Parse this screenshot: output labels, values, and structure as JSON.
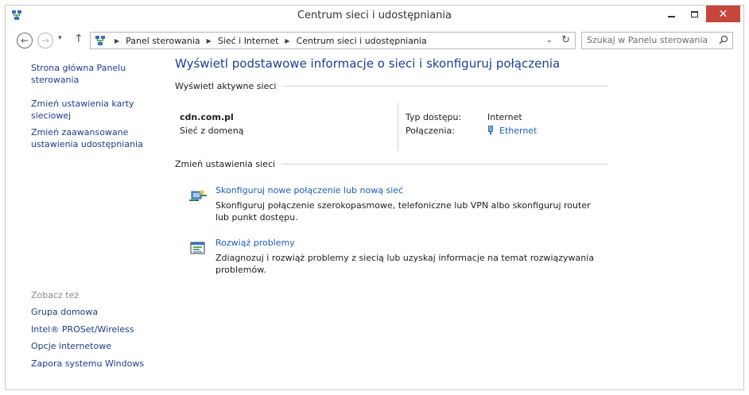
{
  "window": {
    "title": "Centrum sieci i udostępniania",
    "close_glyph": "✕"
  },
  "nav": {
    "back_glyph": "←",
    "forward_glyph": "→",
    "recent_glyph": "▾",
    "up_glyph": "↑",
    "breadcrumbs": [
      "Panel sterowania",
      "Sieć i Internet",
      "Centrum sieci i udostępniania"
    ],
    "crumb_sep": "▶",
    "dropdown_glyph": "⌄",
    "refresh_glyph": "↻",
    "search_placeholder": "Szukaj w Panelu sterowania"
  },
  "sidebar": {
    "links": [
      "Strona główna Panelu sterowania",
      "Zmień ustawienia karty sieciowej",
      "Zmień zaawansowane ustawienia udostępniania"
    ],
    "see_also_heading": "Zobacz też",
    "see_also": [
      "Grupa domowa",
      "Intel® PROSet/Wireless",
      "Opcje internetowe",
      "Zapora systemu Windows"
    ]
  },
  "main": {
    "heading": "Wyświetl podstawowe informacje o sieci i skonfiguruj połączenia",
    "active_section": "Wyświetl aktywne sieci",
    "network": {
      "name": "cdn.com.pl",
      "type": "Sieć z domeną",
      "access_label": "Typ dostępu:",
      "access_value": "Internet",
      "connections_label": "Połączenia:",
      "connections_value": "Ethernet"
    },
    "change_section": "Zmień ustawienia sieci",
    "tasks": [
      {
        "link": "Skonfiguruj nowe połączenie lub nową sieć",
        "desc": "Skonfiguruj połączenie szerokopasmowe, telefoniczne lub VPN albo skonfiguruj router lub punkt dostępu.",
        "icon": "new-connection-icon"
      },
      {
        "link": "Rozwiąż problemy",
        "desc": "Zdiagnozuj i rozwiąż problemy z siecią lub uzyskaj informacje na temat rozwiązywania problemów.",
        "icon": "troubleshoot-icon"
      }
    ]
  },
  "colors": {
    "link": "#1d5fb4",
    "heading": "#1c3f94",
    "close": "#c7463c"
  }
}
